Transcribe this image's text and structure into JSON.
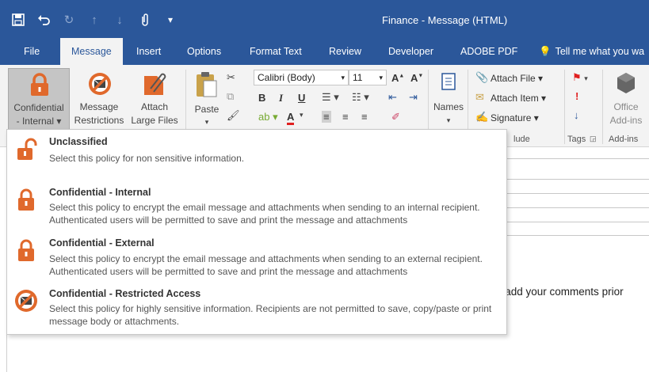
{
  "window": {
    "title": "Finance - Message (HTML)"
  },
  "qat": [
    {
      "icon": "save-icon",
      "glyph": "💾"
    },
    {
      "icon": "undo-icon",
      "glyph": "↶"
    },
    {
      "icon": "redo-icon",
      "glyph": "↻"
    },
    {
      "icon": "up-arrow-icon",
      "glyph": "↑"
    },
    {
      "icon": "down-arrow-icon",
      "glyph": "↓"
    },
    {
      "icon": "attach-icon",
      "glyph": "📎"
    },
    {
      "icon": "customize-icon",
      "glyph": "≡"
    }
  ],
  "tabs": {
    "file": "File",
    "message": "Message",
    "insert": "Insert",
    "options": "Options",
    "format_text": "Format Text",
    "review": "Review",
    "developer": "Developer",
    "adobe_pdf": "ADOBE PDF",
    "tell_me": "Tell me what you wa"
  },
  "ribbon": {
    "confidential": {
      "line1": "Confidential",
      "line2": "- Internal ▾"
    },
    "message_restrictions": {
      "line1": "Message",
      "line2": "Restrictions"
    },
    "attach_large": {
      "line1": "Attach",
      "line2": "Large Files"
    },
    "paste": {
      "label": "Paste",
      "caret": "▾"
    },
    "font": {
      "name": "Calibri (Body)",
      "size": "11"
    },
    "names": {
      "label": "Names",
      "caret": "▾"
    },
    "attach_file": "Attach File ▾",
    "attach_item": "Attach Item ▾",
    "signature": "Signature ▾",
    "office_addins": {
      "line1": "Office",
      "line2": "Add-ins"
    },
    "groups": {
      "include": "lude",
      "tags": "Tags",
      "addins": "Add-ins"
    }
  },
  "background": {
    "comment": "e add your comments prior"
  },
  "policies": [
    {
      "title": "Unclassified",
      "description": "Select this policy for non sensitive information.",
      "icon": "unlocked-padlock-icon"
    },
    {
      "title": "Confidential - Internal",
      "description": "Select this policy to encrypt the email message and attachments when sending to an internal recipient. Authenticated users will be permitted to save and print the message and attachments",
      "icon": "padlock-icon"
    },
    {
      "title": "Confidential - External",
      "description": "Select this policy to encrypt the email message and attachments when sending to an external recipient. Authenticated users will be permitted to save and print the message and attachments",
      "icon": "padlock-icon"
    },
    {
      "title": "Confidential - Restricted Access",
      "description": "Select this policy for highly sensitive information. Recipients are not permitted to save, copy/paste or print message body or attachments.",
      "icon": "no-envelope-icon"
    }
  ],
  "colors": {
    "brand": "#2b579a",
    "accent_orange": "#e0692c",
    "ribbon_bg": "#f3f3f3"
  }
}
